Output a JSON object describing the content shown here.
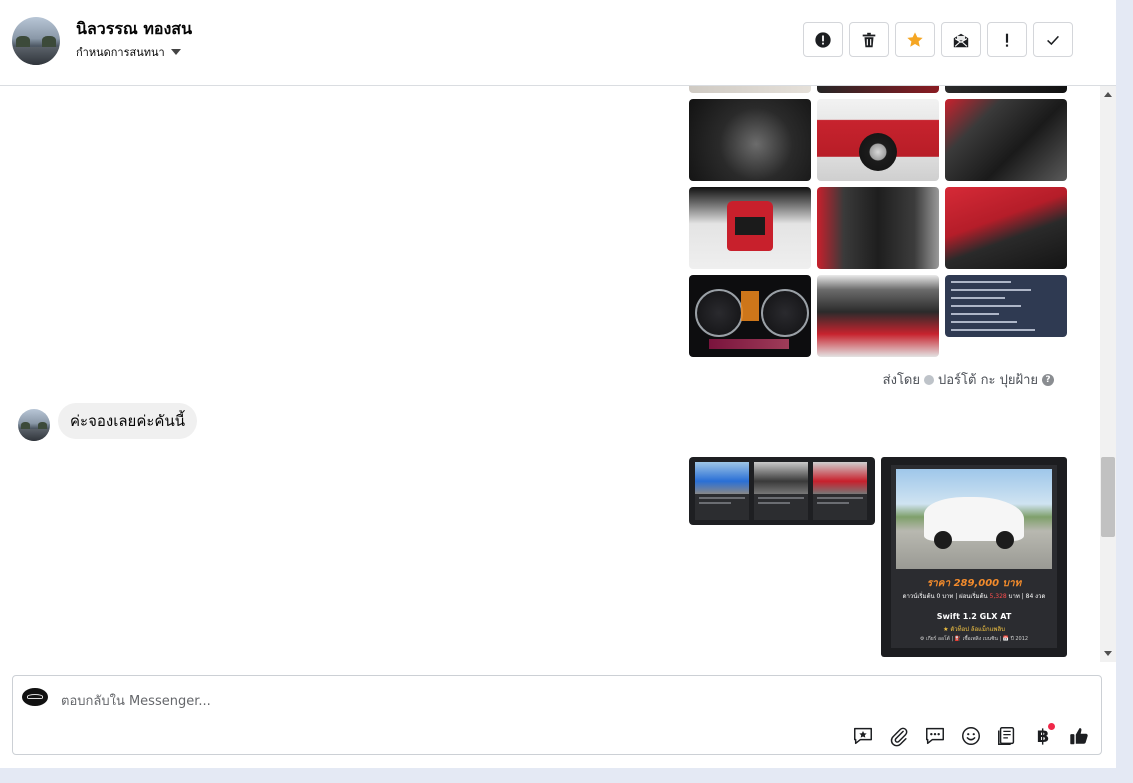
{
  "contact": {
    "name": "นิลวรรณ ทองสน",
    "subtitle": "กำหนดการสนทนา"
  },
  "toolbar": {
    "buttons": [
      {
        "name": "report-icon"
      },
      {
        "name": "trash-icon"
      },
      {
        "name": "star-icon",
        "color": "#f5a623"
      },
      {
        "name": "mark-unread-icon"
      },
      {
        "name": "important-icon"
      },
      {
        "name": "done-check-icon"
      }
    ]
  },
  "thread": {
    "sent_by_prefix": "ส่งโดย",
    "sent_by_name": "ปอร์โต้ กะ ปุยฝ้าย",
    "sent_by_help": "?",
    "incoming_message": "ค่ะจองเลยค่ะคันนี้",
    "listing_card": {
      "price": "ราคา 289,000 บาท",
      "down_prefix": "ดาวน์เริ่มต้น 0 บาท | ผ่อนเริ่มต้น",
      "installment": "5,328",
      "down_suffix": "บาท | 84 งวด",
      "model": "Swift 1.2 GLX AT",
      "tagline": "★ ตัวท็อป ล้อแม็กแพลิบ",
      "footer": "⚙ เกียร์ ออโต้ | ⛽ เชื้อเพลิง เบนซิน | 📅 ปี 2012"
    }
  },
  "composer": {
    "placeholder": "ตอบกลับใน Messenger...",
    "icons": [
      "saved-reply-icon",
      "attachment-icon",
      "quick-reply-icon",
      "emoji-icon",
      "catalog-icon",
      "baht-payment-icon",
      "like-icon"
    ],
    "baht_symbol": "฿"
  }
}
